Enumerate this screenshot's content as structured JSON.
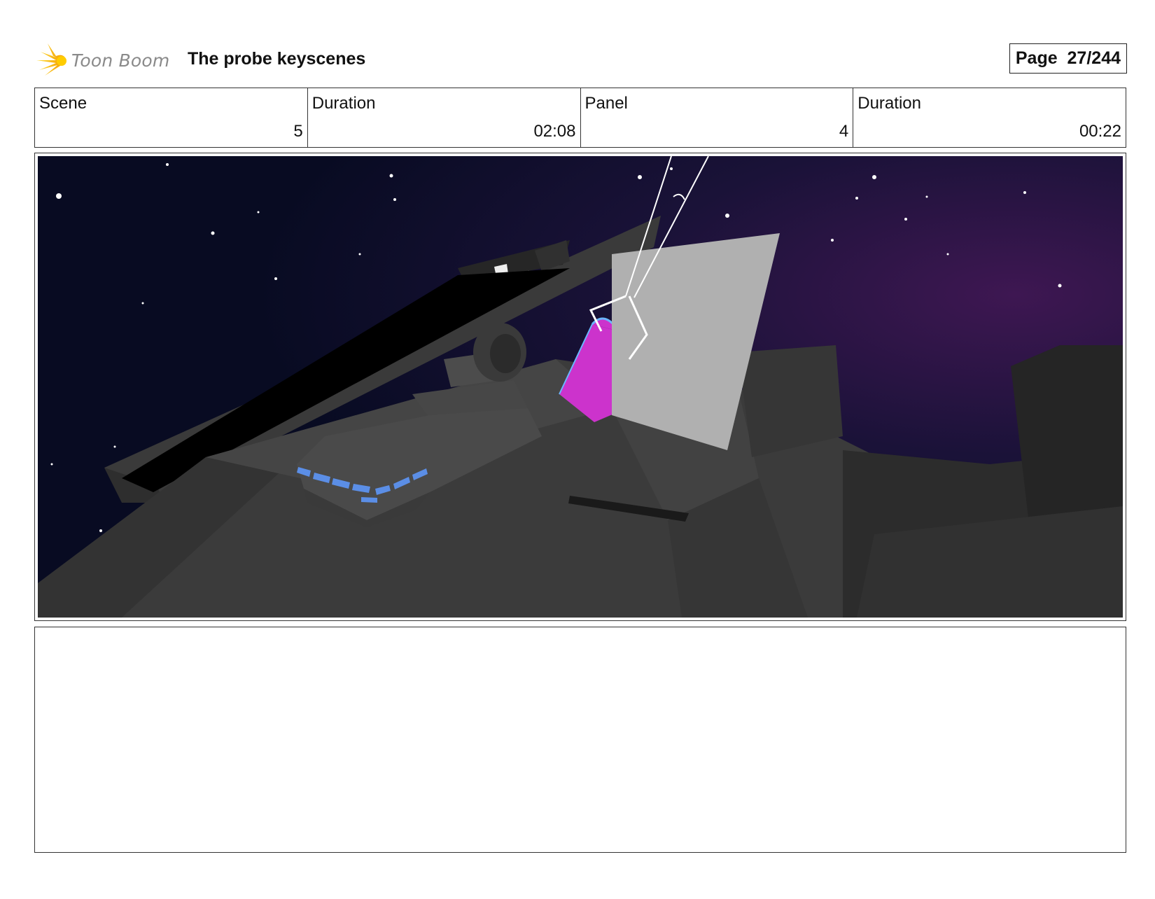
{
  "header": {
    "logo_text": "Toon Boom",
    "logo_icon": "burst-icon",
    "title": "The probe keyscenes",
    "page_label": "Page",
    "page_value": "27/244"
  },
  "info": [
    {
      "label": "Scene",
      "value": "5"
    },
    {
      "label": "Duration",
      "value": "02:08"
    },
    {
      "label": "Panel",
      "value": "4"
    },
    {
      "label": "Duration",
      "value": "00:22"
    }
  ],
  "colors": {
    "accent_logo": "#f5b800",
    "space_dark": "#090c24",
    "space_purple": "#3a1650",
    "ship_gray": "#4a4a4a",
    "probe_magenta": "#cc33cc",
    "panel_lights": "#5b8ee6",
    "plate_gray": "#b0b0b0"
  }
}
